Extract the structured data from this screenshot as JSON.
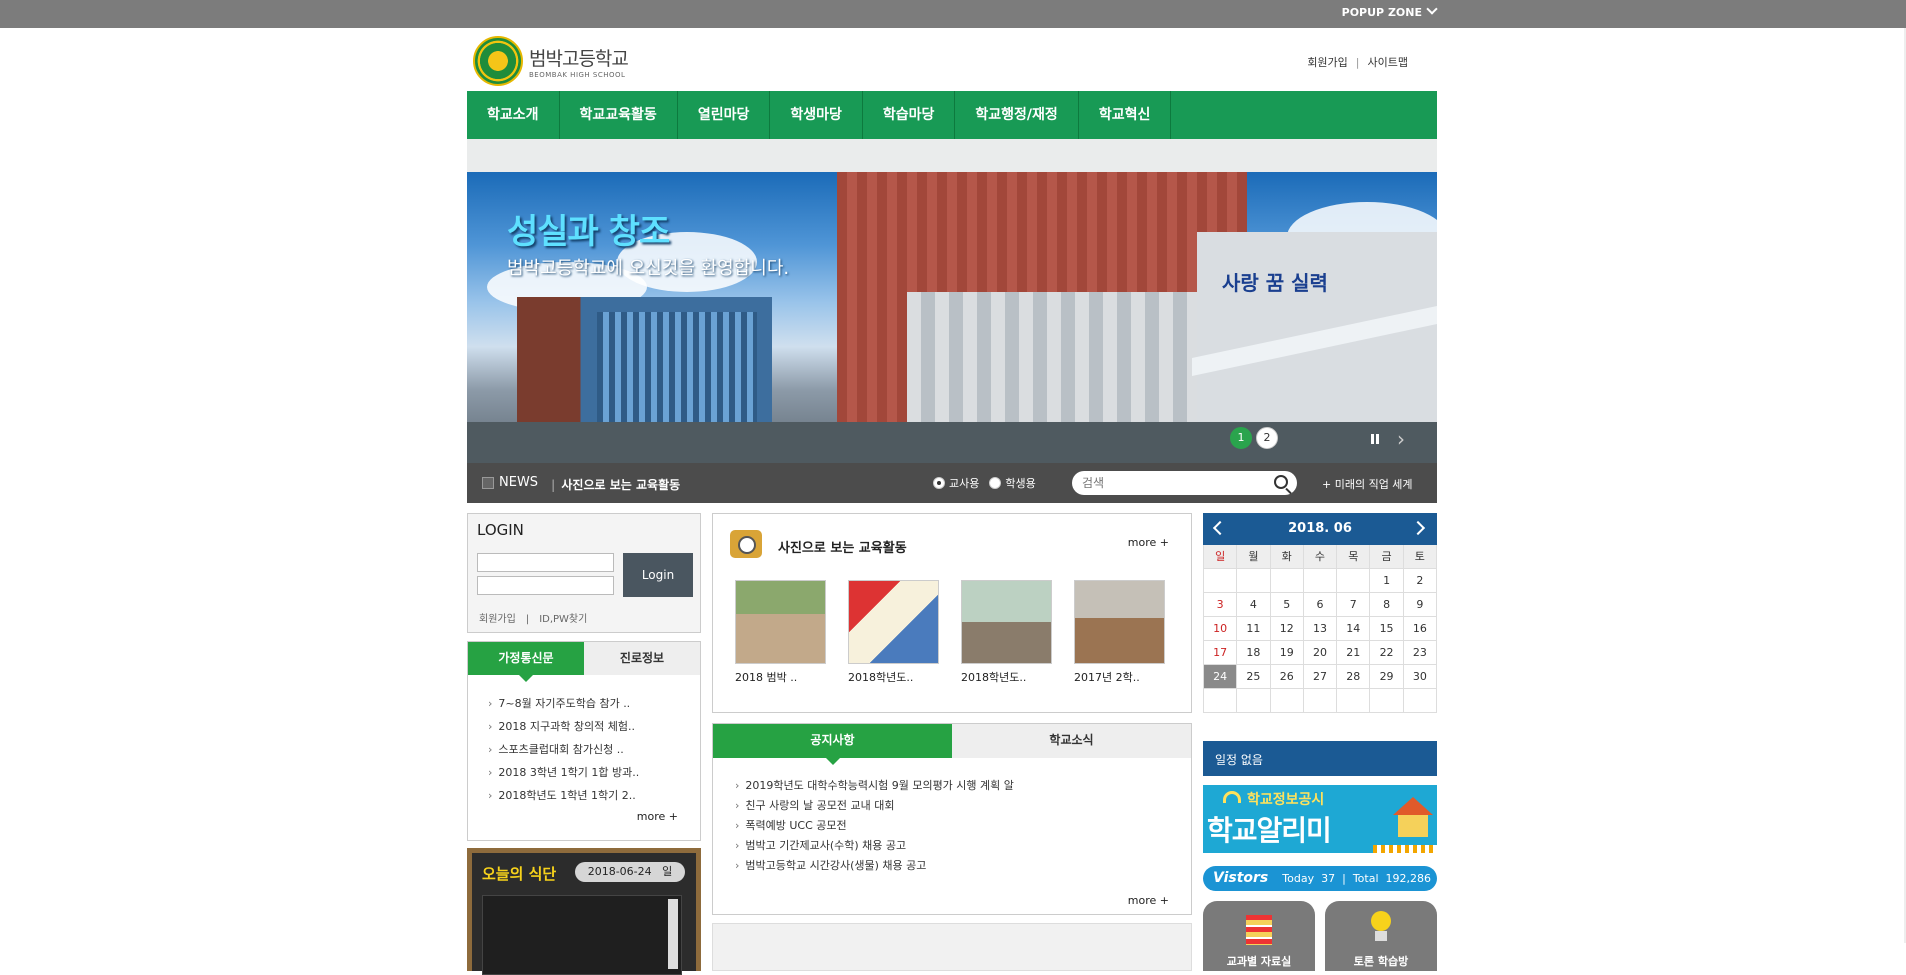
{
  "popup": {
    "label": "POPUP ZONE"
  },
  "header": {
    "logo_ko": "범박고등학교",
    "logo_en": "BEOMBAK HIGH SCHOOL",
    "util_join": "회원가입",
    "util_sep": "|",
    "util_sitemap": "사이트맵"
  },
  "gnb": [
    "학교소개",
    "학교교육활동",
    "열린마당",
    "학생마당",
    "학습마당",
    "학교행정/재정",
    "학교혁신"
  ],
  "visual": {
    "title": "성실과 창조",
    "subtitle": "범박고등학교에 오신것을 환영합니다.",
    "wall_text": "사랑 꿈 실력",
    "dots": [
      "1",
      "2"
    ],
    "next_arrow": "›"
  },
  "newsbar": {
    "news": "NEWS",
    "title": "사진으로 보는 교육활동",
    "radio_teacher": "교사용",
    "radio_student": "학생용",
    "search_placeholder": "검색",
    "future": "+ 미래의 직업 세계"
  },
  "login": {
    "title": "LOGIN",
    "button": "Login",
    "join": "회원가입",
    "sep": "|",
    "find": "ID,PW찾기"
  },
  "home_letters": {
    "tab_on": "가정통신문",
    "tab_off": "진로정보",
    "items": [
      "7~8월 자기주도학습 참가 ..",
      "2018 지구과학 창의적 체험..",
      "스포츠클럽대회 참가신청 ..",
      "2018 3학년 1학기 1합 방과..",
      "2018학년도 1학년 1학기 2.."
    ],
    "more": "more +"
  },
  "meal": {
    "title": "오늘의 식단",
    "date": "2018-06-24",
    "day": "일"
  },
  "photo": {
    "title": "사진으로 보는 교육활동",
    "more": "more +",
    "items": [
      "2018 범박 ..",
      "2018학년도..",
      "2018학년도..",
      "2017년 2학.."
    ]
  },
  "notice": {
    "tab_on": "공지사항",
    "tab_off": "학교소식",
    "items": [
      "2019학년도 대학수학능력시험 9월 모의평가 시행 계획 알",
      "친구 사랑의 날 공모전 교내 대회",
      "폭력예방 UCC 공모전",
      "범박고 기간제교사(수학) 채용 공고",
      "범박고등학교 시간강사(생물) 채용 공고"
    ],
    "more": "more +"
  },
  "calendar": {
    "title": "2018. 06",
    "weekdays": [
      "일",
      "월",
      "화",
      "수",
      "목",
      "금",
      "토"
    ],
    "cells": [
      "",
      "",
      "",
      "",
      "",
      "1",
      "2",
      "3",
      "4",
      "5",
      "6",
      "7",
      "8",
      "9",
      "10",
      "11",
      "12",
      "13",
      "14",
      "15",
      "16",
      "17",
      "18",
      "19",
      "20",
      "21",
      "22",
      "23",
      "24",
      "25",
      "26",
      "27",
      "28",
      "29",
      "30",
      "",
      "",
      "",
      "",
      "",
      "",
      ""
    ],
    "today": "24",
    "schedule": "일정 없음"
  },
  "alimi": {
    "top": "학교정보공시",
    "main": "학교알리미"
  },
  "visitors": {
    "title": "Vistors",
    "today_label": "Today",
    "today": "37",
    "sep": "|",
    "total_label": "Total",
    "total": "192,286"
  },
  "quick": {
    "subject": "교과별 자료실",
    "debate": "토론 학습방"
  }
}
